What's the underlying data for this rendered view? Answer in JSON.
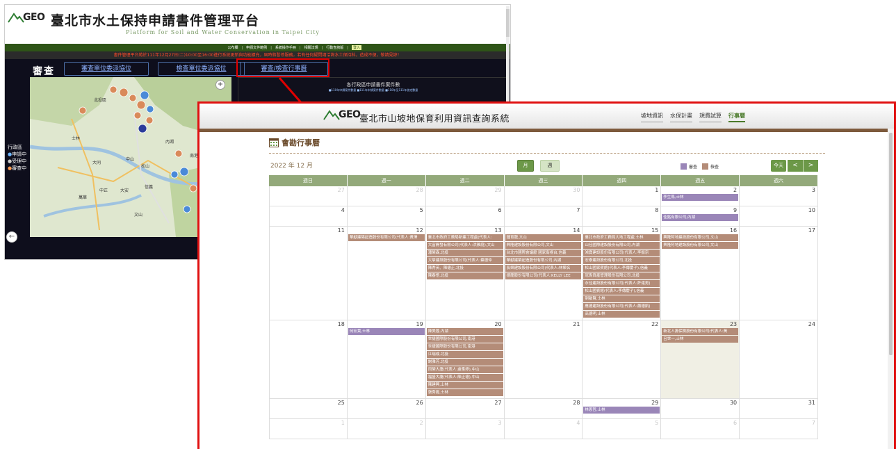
{
  "background_window": {
    "logo_text": "GEO",
    "title": "臺北市水土保持申請書件管理平台",
    "subtitle": "Platform for Soil and Water Conservation in Taipei City",
    "nav": [
      "公布欄",
      "申請文件範例",
      "系統操作手冊",
      "相關法規",
      "行動查詢版"
    ],
    "nav_highlight": "登入",
    "notice": "書件管理平台將於111年12月27日(二)10:00至16:00進行系統更新與功能擴充，屆時將暫停服務，若有任何疑問請洽詢水土保持科，造成不便，敬請見諒！",
    "review_title": "審查",
    "tabs": [
      "審查單位委派協位",
      "檢查單位委派協位",
      "審查/檢查行事曆"
    ],
    "chart_title": "各行政區申請書件案件數",
    "chart_legend": "■110年申請案件數量 ■111年申請案件數量 ■110年至111年核定數量",
    "side_legend_title": "行政區",
    "side_legend": [
      "申請中",
      "受理中",
      "審查中"
    ],
    "map_labels": [
      "北投區",
      "士林",
      "中山",
      "大同",
      "中正",
      "大安",
      "信義",
      "南港",
      "內湖",
      "萬華",
      "文山",
      "松山"
    ],
    "colors": {
      "nav_green": "#2e5417",
      "notice_red": "#ff4b2b",
      "panel_dark": "#0e0e1c",
      "highlight_red": "#e00000"
    }
  },
  "foreground_window": {
    "logo_text": "GEO",
    "title": "臺北市山坡地保育利用資訊查詢系統",
    "nav": [
      {
        "label": "坡地資訊",
        "active": false
      },
      {
        "label": "水保計畫",
        "active": false
      },
      {
        "label": "規費試算",
        "active": false
      },
      {
        "label": "行事曆",
        "active": true
      }
    ],
    "section_title": "會勘行事曆",
    "month_title": "2022 年 12 月",
    "view_month": "月",
    "view_week": "週",
    "legend": [
      {
        "label": "審查",
        "color": "#9a86b8"
      },
      {
        "label": "檢查",
        "color": "#b48c78"
      }
    ],
    "today_label": "今天",
    "prev_label": "<",
    "next_label": ">",
    "weekdays": [
      "週日",
      "週一",
      "週二",
      "週三",
      "週四",
      "週五",
      "週六"
    ],
    "weeks": [
      [
        {
          "day": "27",
          "other": true,
          "events": []
        },
        {
          "day": "28",
          "other": true,
          "events": []
        },
        {
          "day": "29",
          "other": true,
          "events": []
        },
        {
          "day": "30",
          "other": true,
          "events": []
        },
        {
          "day": "1",
          "other": false,
          "events": []
        },
        {
          "day": "2",
          "other": false,
          "events": [
            {
              "text": "李生馬,士林",
              "type": "purple"
            }
          ]
        },
        {
          "day": "3",
          "other": false,
          "events": []
        }
      ],
      [
        {
          "day": "4",
          "other": false,
          "events": []
        },
        {
          "day": "5",
          "other": false,
          "events": []
        },
        {
          "day": "6",
          "other": false,
          "events": []
        },
        {
          "day": "7",
          "other": false,
          "events": []
        },
        {
          "day": "8",
          "other": false,
          "events": []
        },
        {
          "day": "9",
          "other": false,
          "events": [
            {
              "text": "佳銘有限公司,內湖",
              "type": "purple"
            }
          ]
        },
        {
          "day": "10",
          "other": false,
          "events": []
        }
      ],
      [
        {
          "day": "11",
          "other": false,
          "events": []
        },
        {
          "day": "12",
          "other": false,
          "events": [
            {
              "text": "華獻建築起造股份有限公司(代表人:黃澤",
              "type": "brown"
            }
          ]
        },
        {
          "day": "13",
          "other": false,
          "events": [
            {
              "text": "臺北市政府工務局新建工程處(代表人:",
              "type": "brown"
            },
            {
              "text": "大富開發有限公司(代表人:洪雅庭),文山",
              "type": "brown"
            },
            {
              "text": "潘榮森,北投",
              "type": "brown"
            },
            {
              "text": "大擘建設股份有限公司(代表人:蔡德仲",
              "type": "brown"
            },
            {
              "text": "陳秀英、陳德正,北投",
              "type": "brown"
            },
            {
              "text": "陳春悟,北投",
              "type": "brown"
            }
          ]
        },
        {
          "day": "14",
          "other": false,
          "events": [
            {
              "text": "鍾育龍,文山",
              "type": "brown"
            },
            {
              "text": "興隆建設股份有限公司,文山",
              "type": "brown"
            },
            {
              "text": "台北市國際會議廳 國家衛視台,信義",
              "type": "brown"
            },
            {
              "text": "華獻建築起造股份有限公司,內湖",
              "type": "brown"
            },
            {
              "text": "長榮建設股份有限公司(代表人:林榮名",
              "type": "brown"
            },
            {
              "text": "德龍股份有限公司(代表人:KELLY LEE",
              "type": "brown"
            }
          ]
        },
        {
          "day": "15",
          "other": false,
          "events": [
            {
              "text": "臺北市政府工務局大地工程處,士林",
              "type": "brown"
            },
            {
              "text": "山佳國際建設股份有限公司,內湖",
              "type": "brown"
            },
            {
              "text": "鴻寶建設股份有限公司(代表人:李振宗",
              "type": "brown"
            },
            {
              "text": "宏泰建設股份有限公司,北投",
              "type": "brown"
            },
            {
              "text": "松山國家賓館(代表人:李傳慶子),信義",
              "type": "brown"
            },
            {
              "text": "冠馬資產管理股份有限公司,北投",
              "type": "brown"
            },
            {
              "text": "永佳建設股份有限公司(代表人:許達男)",
              "type": "brown"
            },
            {
              "text": "松山國賓館(代表人:李傳慶子),信義",
              "type": "brown"
            },
            {
              "text": "劉敏賢,士林",
              "type": "brown"
            },
            {
              "text": "應德建設股份有限公司(代表人:蕭德凱)",
              "type": "brown"
            },
            {
              "text": "高德明,士林",
              "type": "brown"
            }
          ]
        },
        {
          "day": "16",
          "other": false,
          "events": [
            {
              "text": "興隆阿地建設股份有限公司,文山",
              "type": "brown"
            },
            {
              "text": "興隆阿地建設股份有限公司,文山",
              "type": "brown"
            }
          ]
        },
        {
          "day": "17",
          "other": false,
          "events": []
        }
      ],
      [
        {
          "day": "18",
          "other": false,
          "events": []
        },
        {
          "day": "19",
          "other": false,
          "events": [
            {
              "text": "何宏貴,士林",
              "type": "purple"
            }
          ]
        },
        {
          "day": "20",
          "other": false,
          "events": [
            {
              "text": "陳美蓉,內湖",
              "type": "brown"
            },
            {
              "text": "世捷國際股份有限公司,南港",
              "type": "brown"
            },
            {
              "text": "世捷國際股份有限公司,南港",
              "type": "brown"
            },
            {
              "text": "江瑞成,北投",
              "type": "brown"
            },
            {
              "text": "謝雅芳,北投",
              "type": "brown"
            },
            {
              "text": "同榮大廈(代表人:盧柔婷),中山",
              "type": "brown"
            },
            {
              "text": "福盛大廈(代表人:陳正德),中山",
              "type": "brown"
            },
            {
              "text": "陳建興,士林",
              "type": "brown"
            },
            {
              "text": "張秀鳳,士林",
              "type": "brown"
            }
          ]
        },
        {
          "day": "21",
          "other": false,
          "events": []
        },
        {
          "day": "22",
          "other": false,
          "events": []
        },
        {
          "day": "23",
          "other": false,
          "today": true,
          "events": [
            {
              "text": "新北人壽保險股份有限公司(代表人:黃",
              "type": "brown"
            },
            {
              "text": "呂世一,士林",
              "type": "brown"
            }
          ]
        },
        {
          "day": "24",
          "other": false,
          "events": []
        }
      ],
      [
        {
          "day": "25",
          "other": false,
          "events": []
        },
        {
          "day": "26",
          "other": false,
          "events": []
        },
        {
          "day": "27",
          "other": false,
          "events": []
        },
        {
          "day": "28",
          "other": false,
          "events": []
        },
        {
          "day": "29",
          "other": false,
          "events": [
            {
              "text": "林恩哲,士林",
              "type": "purple"
            }
          ]
        },
        {
          "day": "30",
          "other": false,
          "events": []
        },
        {
          "day": "31",
          "other": false,
          "events": []
        }
      ],
      [
        {
          "day": "1",
          "other": true,
          "events": []
        },
        {
          "day": "2",
          "other": true,
          "events": []
        },
        {
          "day": "3",
          "other": true,
          "events": []
        },
        {
          "day": "4",
          "other": true,
          "events": []
        },
        {
          "day": "5",
          "other": true,
          "events": []
        },
        {
          "day": "6",
          "other": true,
          "events": []
        },
        {
          "day": "7",
          "other": true,
          "events": []
        }
      ]
    ],
    "colors": {
      "border_red": "#e01010",
      "green": "#6c9848",
      "brown_bar": "#7d5a3c",
      "header_green": "#93a97a"
    }
  }
}
